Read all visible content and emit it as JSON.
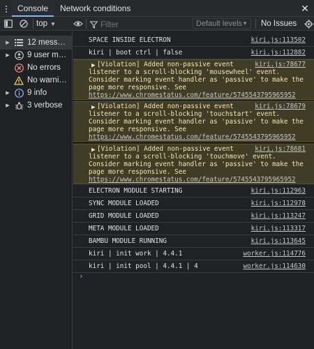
{
  "tabs": {
    "console": "Console",
    "network": "Network conditions"
  },
  "toolbar": {
    "context": "top",
    "filter_placeholder": "Filter",
    "levels": "Default levels",
    "issues": "No Issues"
  },
  "sidebar": {
    "items": [
      {
        "label": "12 messa…",
        "icon": "list-icon"
      },
      {
        "label": "9 user m…",
        "icon": "user-icon"
      },
      {
        "label": "No errors",
        "icon": "error-icon"
      },
      {
        "label": "No warni…",
        "icon": "warning-icon"
      },
      {
        "label": "9 info",
        "icon": "info-icon"
      },
      {
        "label": "3 verbose",
        "icon": "bug-icon"
      }
    ]
  },
  "console": {
    "rows": [
      {
        "msg": "SPACE INSIDE ELECTRON",
        "src": "kiri.js:113502"
      },
      {
        "msg": "kiri | boot ctrl | false",
        "src": "kiri.js:112882"
      },
      {
        "line1": "[Violation] Added non-passive event",
        "line2": "listener to a scroll-blocking 'mousewheel' event.",
        "line3": "Consider marking event handler as 'passive' to make the",
        "line4": "page more responsive. See",
        "link": "https://www.chromestatus.com/feature/5745543795965952",
        "src": "kiri.js:78677"
      },
      {
        "line1": "[Violation] Added non-passive event",
        "line2": "listener to a scroll-blocking 'touchstart' event.",
        "line3": "Consider marking event handler as 'passive' to make the",
        "line4": "page more responsive. See",
        "link": "https://www.chromestatus.com/feature/5745543795965952",
        "src": "kiri.js:78679"
      },
      {
        "line1": "[Violation] Added non-passive event",
        "line2": "listener to a scroll-blocking 'touchmove' event.",
        "line3": "Consider marking event handler as 'passive' to make the",
        "line4": "page more responsive. See",
        "link": "https://www.chromestatus.com/feature/5745543795965952",
        "src": "kiri.js:78681"
      },
      {
        "msg": "ELECTRON MODULE STARTING",
        "src": "kiri.js:112963"
      },
      {
        "msg": "SYNC MODULE LOADED",
        "src": "kiri.js:112978"
      },
      {
        "msg": "GRID MODULE LOADED",
        "src": "kiri.js:113247"
      },
      {
        "msg": "META MODULE LOADED",
        "src": "kiri.js:113317"
      },
      {
        "msg": "BAMBU MODULE RUNNING",
        "src": "kiri.js:113645"
      },
      {
        "msg": "kiri | init work | 4.4.1",
        "src": "worker.js:114776"
      },
      {
        "msg": "kiri | init pool | 4.4.1 | 4",
        "src": "worker.js:114630"
      }
    ]
  },
  "colors": {
    "accent": "#8ab4f8",
    "warning_bg": "#413c26",
    "background": "#202124"
  }
}
